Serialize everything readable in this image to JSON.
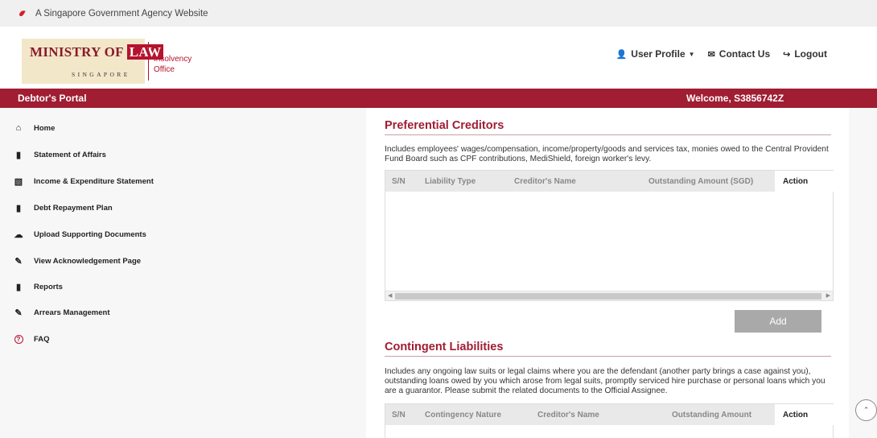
{
  "gov_banner": {
    "text": "A Singapore Government Agency Website"
  },
  "logo": {
    "title_prefix": "MINISTRY OF ",
    "title_highlight": "LAW",
    "subtitle": "SINGAPORE",
    "office_line1": "Insolvency",
    "office_line2": "Office"
  },
  "top_nav": {
    "user_profile": "User Profile",
    "contact_us": "Contact Us",
    "logout": "Logout"
  },
  "portal_bar": {
    "title": "Debtor's Portal",
    "welcome": "Welcome, S3856742Z"
  },
  "sidebar": {
    "items": [
      {
        "label": "Home",
        "icon": "home-icon"
      },
      {
        "label": "Statement of Affairs",
        "icon": "document-icon"
      },
      {
        "label": "Income & Expenditure Statement",
        "icon": "ledger-icon"
      },
      {
        "label": "Debt Repayment Plan",
        "icon": "plan-icon"
      },
      {
        "label": "Upload Supporting Documents",
        "icon": "cloud-upload-icon"
      },
      {
        "label": "View Acknowledgement Page",
        "icon": "edit-document-icon"
      },
      {
        "label": "Reports",
        "icon": "report-icon"
      },
      {
        "label": "Arrears Management",
        "icon": "edit-document-icon"
      },
      {
        "label": "FAQ",
        "icon": "question-circle-icon"
      }
    ]
  },
  "preferential": {
    "title": "Preferential Creditors",
    "description": "Includes employees' wages/compensation, income/property/goods and services tax, monies owed to the Central Provident Fund Board such as CPF contributions, MediShield, foreign worker's levy.",
    "columns": [
      "S/N",
      "Liability Type",
      "Creditor's Name",
      "Outstanding Amount (SGD)",
      "Action"
    ],
    "add_label": "Add"
  },
  "contingent": {
    "title": "Contingent Liabilities",
    "description": "Includes any ongoing law suits or legal claims where you are the defendant (another party brings a case against you), outstanding loans owed by you which arose from legal suits, promptly serviced hire purchase or personal loans which you are a guarantor. Please submit the related documents to the Official Assignee.",
    "columns": [
      "S/N",
      "Contingency Nature",
      "Creditor's Name",
      "Outstanding Amount",
      "Action"
    ]
  },
  "colors": {
    "brand": "#a01d32",
    "button_disabled": "#a9a9a9"
  }
}
